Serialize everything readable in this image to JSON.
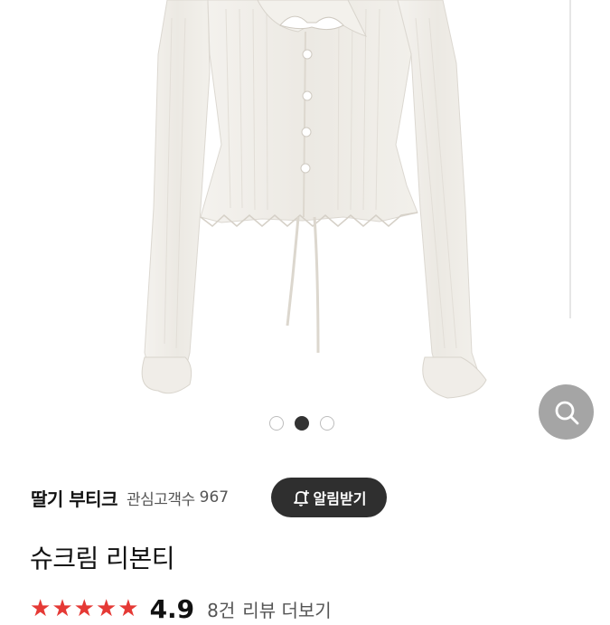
{
  "product_image": {
    "alt": "",
    "pager_total": 3,
    "pager_active_index": 1
  },
  "zoom": {
    "icon": "search-icon"
  },
  "shop": {
    "name": "딸기 부티크",
    "follower_label": "관심고객수",
    "follower_count": "967"
  },
  "notify_button": {
    "label": "알림받기",
    "icon": "bell-plus-icon"
  },
  "product": {
    "title": "슈크림 리본티"
  },
  "rating": {
    "value": "4.9",
    "stars": 5,
    "review_count": "8건",
    "review_label": "리뷰 더보기"
  },
  "colors": {
    "accent_star": "#e53935",
    "button_bg": "#2f2f2f"
  }
}
